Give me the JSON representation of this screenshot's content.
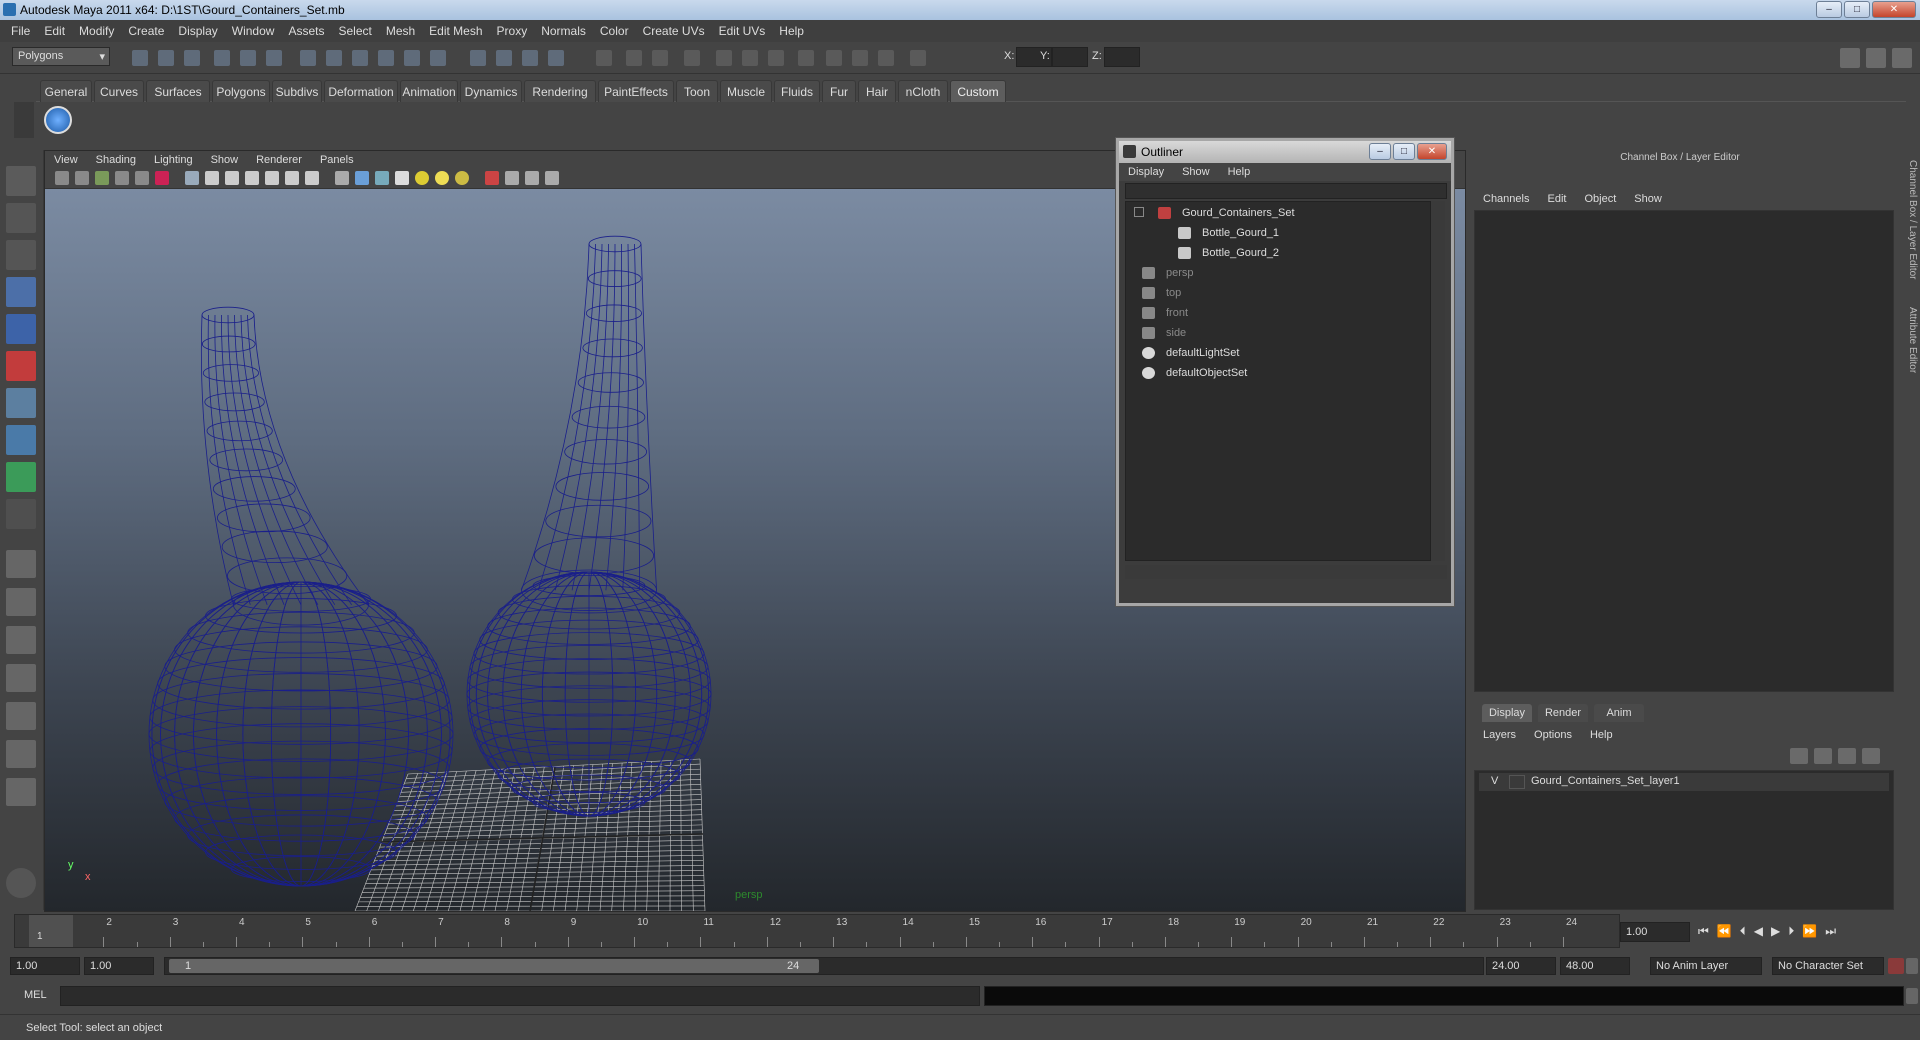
{
  "window": {
    "title": "Autodesk Maya 2011 x64: D:\\1ST\\Gourd_Containers_Set.mb"
  },
  "menubar": [
    "File",
    "Edit",
    "Modify",
    "Create",
    "Display",
    "Window",
    "Assets",
    "Select",
    "Mesh",
    "Edit Mesh",
    "Proxy",
    "Normals",
    "Color",
    "Create UVs",
    "Edit UVs",
    "Help"
  ],
  "status_line": {
    "menu_set": "Polygons",
    "x_label": "X:",
    "y_label": "Y:",
    "z_label": "Z:"
  },
  "shelf_tabs": [
    "General",
    "Curves",
    "Surfaces",
    "Polygons",
    "Subdivs",
    "Deformation",
    "Animation",
    "Dynamics",
    "Rendering",
    "PaintEffects",
    "Toon",
    "Muscle",
    "Fluids",
    "Fur",
    "Hair",
    "nCloth",
    "Custom"
  ],
  "shelf_active_tab": "Custom",
  "viewport": {
    "menu": [
      "View",
      "Shading",
      "Lighting",
      "Show",
      "Renderer",
      "Panels"
    ],
    "camera_label": "persp",
    "axis_y": "y",
    "axis_x": "x"
  },
  "outliner": {
    "title": "Outliner",
    "menu": [
      "Display",
      "Show",
      "Help"
    ],
    "items": [
      {
        "label": "Gourd_Containers_Set",
        "icon": "set-icon",
        "dim": false
      },
      {
        "label": "Bottle_Gourd_1",
        "icon": "mesh-icon",
        "dim": false
      },
      {
        "label": "Bottle_Gourd_2",
        "icon": "mesh-icon",
        "dim": false
      },
      {
        "label": "persp",
        "icon": "camera-icon",
        "dim": true
      },
      {
        "label": "top",
        "icon": "camera-icon",
        "dim": true
      },
      {
        "label": "front",
        "icon": "camera-icon",
        "dim": true
      },
      {
        "label": "side",
        "icon": "camera-icon",
        "dim": true
      },
      {
        "label": "defaultLightSet",
        "icon": "light-set-icon",
        "dim": false
      },
      {
        "label": "defaultObjectSet",
        "icon": "object-set-icon",
        "dim": false
      }
    ]
  },
  "channel_box": {
    "title": "Channel Box / Layer Editor",
    "menu": [
      "Channels",
      "Edit",
      "Object",
      "Show"
    ],
    "side_tabs": [
      "Channel Box / Layer Editor",
      "Attribute Editor"
    ]
  },
  "layer_editor": {
    "tabs": [
      "Display",
      "Render",
      "Anim"
    ],
    "menu": [
      "Layers",
      "Options",
      "Help"
    ],
    "layer": {
      "visible": "V",
      "name": "Gourd_Containers_Set_layer1"
    }
  },
  "timeline": {
    "ticks": [
      "1",
      "2",
      "3",
      "4",
      "5",
      "6",
      "7",
      "8",
      "9",
      "10",
      "11",
      "12",
      "13",
      "14",
      "15",
      "16",
      "17",
      "18",
      "19",
      "20",
      "21",
      "22",
      "23",
      "24"
    ],
    "current_frame_marker": "1",
    "current_time": "1.00"
  },
  "range_slider": {
    "start_time": "1.00",
    "playback_start": "1.00",
    "slider_start": "1",
    "slider_end": "24",
    "playback_end": "24.00",
    "end_time": "48.00",
    "anim_layer": "No Anim Layer",
    "character_set": "No Character Set"
  },
  "command_line": {
    "label": "MEL"
  },
  "help_line": {
    "text": "Select Tool: select an object"
  },
  "colors": {
    "wire": "#1a1f8a",
    "grid": "#c8c8c8",
    "persp_label": "#2d8a2d"
  }
}
